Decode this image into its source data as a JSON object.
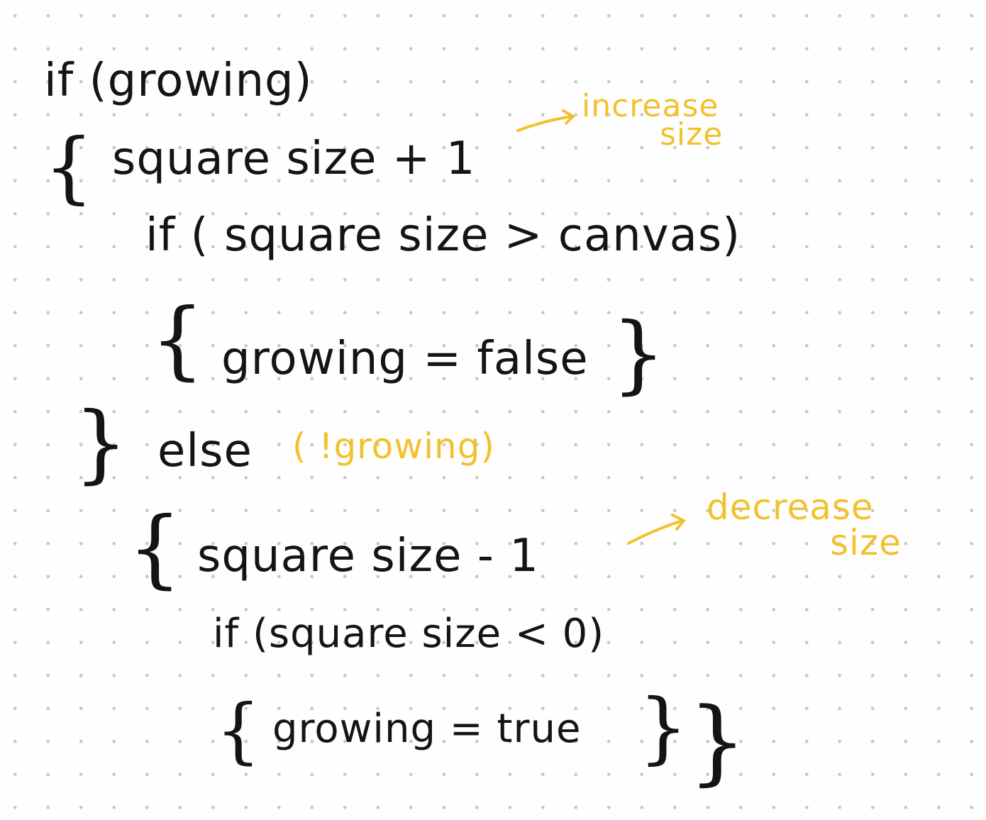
{
  "lines": {
    "l1": "if (growing)",
    "l2_brace": "{",
    "l2": "square size + 1",
    "l3": "if ( square size > canvas)",
    "l4_open": "{",
    "l4": "growing = false",
    "l4_close": "}",
    "l5_close": "}",
    "l5": "else",
    "l6_brace": "{",
    "l6": "square size - 1",
    "l7": "if (square size < 0)",
    "l8_open": "{",
    "l8": "growing = true",
    "l8_close": "}",
    "l8_close2": "}"
  },
  "annotations": {
    "increase_1": "increase",
    "increase_2": "size",
    "else_condition": "( !growing)",
    "decrease_1": "decrease",
    "decrease_2": "size"
  },
  "colors": {
    "ink": "#141414",
    "highlight": "#f2c12e",
    "dots": "#c9c9c9",
    "paper": "#fefefe"
  }
}
